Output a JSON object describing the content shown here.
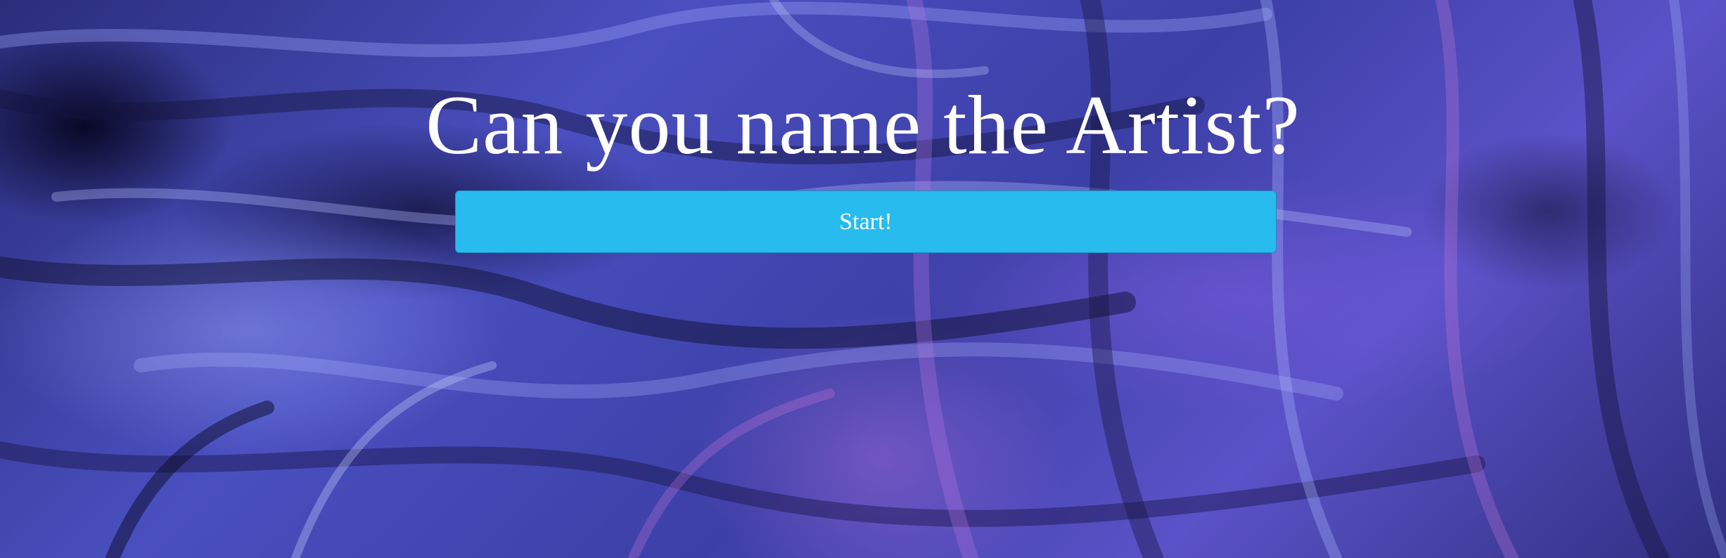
{
  "page": {
    "title": "Can you name the Artist?",
    "start_button_label": "Start!"
  },
  "colors": {
    "button_bg": "#27bbee",
    "title_text": "#ffffff",
    "background_primary": "#3c3fa6"
  }
}
